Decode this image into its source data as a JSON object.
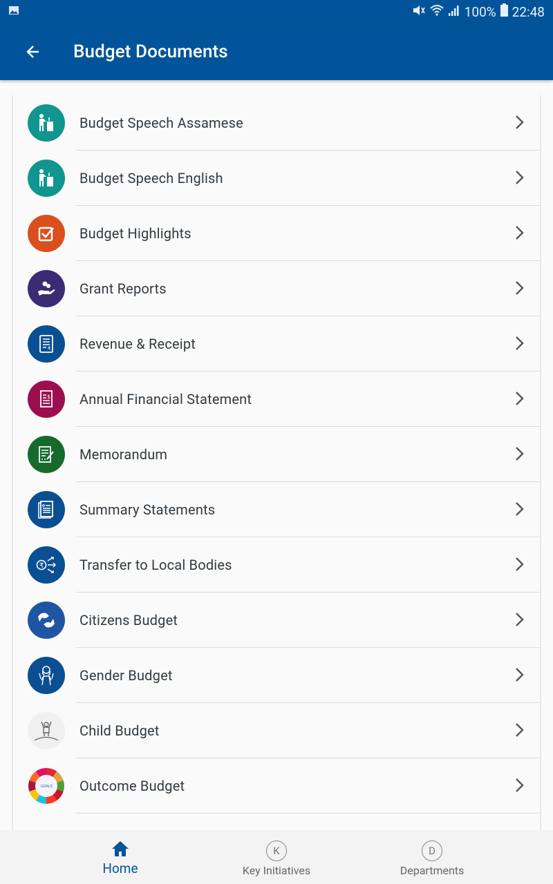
{
  "status_bar": {
    "battery": "100%",
    "time": "22:48",
    "icons": [
      "gallery-icon",
      "mute-icon",
      "wifi-icon",
      "signal-icon",
      "battery-icon"
    ]
  },
  "app_bar": {
    "title": "Budget Documents",
    "back_icon": "arrow-left-icon"
  },
  "colors": {
    "primary": "#02549a",
    "list_text": "#333a40"
  },
  "documents": [
    {
      "label": "Budget Speech Assamese",
      "icon": "podium-speaker-icon",
      "color": "#10958f"
    },
    {
      "label": "Budget Speech English",
      "icon": "podium-speaker-icon",
      "color": "#10958f"
    },
    {
      "label": "Budget Highlights",
      "icon": "checkbox-icon",
      "color": "#d9501e"
    },
    {
      "label": "Grant Reports",
      "icon": "hand-coins-icon",
      "color": "#3b2a74"
    },
    {
      "label": "Revenue & Receipt",
      "icon": "receipt-rupee-icon",
      "color": "#0b4f93"
    },
    {
      "label": "Annual Financial Statement",
      "icon": "document-dollar-icon",
      "color": "#9c0f4f"
    },
    {
      "label": "Memorandum",
      "icon": "document-pen-icon",
      "color": "#166b2c"
    },
    {
      "label": "Summary Statements",
      "icon": "document-list-icon",
      "color": "#0b4f93"
    },
    {
      "label": "Transfer to Local Bodies",
      "icon": "rupee-transfer-icon",
      "color": "#0b4f93"
    },
    {
      "label": "Citizens Budget",
      "icon": "handshake-icon",
      "color": "#1f55a3"
    },
    {
      "label": "Gender Budget",
      "icon": "woman-icon",
      "color": "#0b4f93"
    },
    {
      "label": "Child Budget",
      "icon": "child-icon",
      "color": "#f0f0f0"
    },
    {
      "label": "Outcome Budget",
      "icon": "sdg-goals-wheel-icon",
      "color": "#ffffff"
    }
  ],
  "bottom_nav": [
    {
      "label": "Home",
      "icon": "home-icon",
      "active": true
    },
    {
      "label": "Key Initiatives",
      "icon_letter": "K",
      "active": false
    },
    {
      "label": "Departments",
      "icon_letter": "D",
      "active": false
    }
  ]
}
